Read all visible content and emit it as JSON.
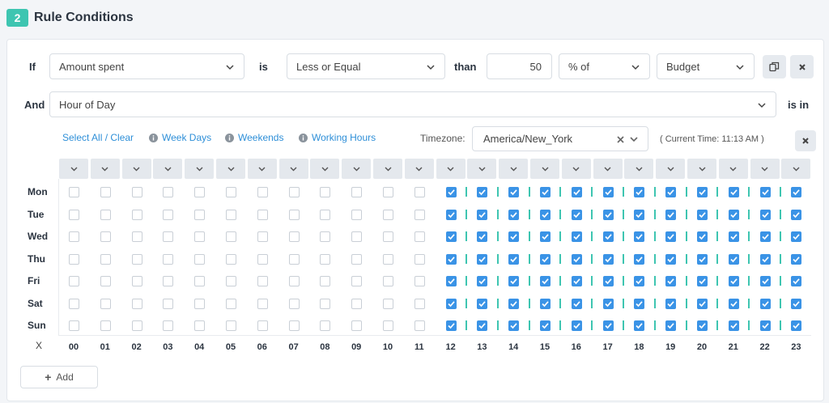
{
  "header": {
    "step_number": "2",
    "title": "Rule Conditions"
  },
  "condition": {
    "if_label": "If",
    "metric": "Amount spent",
    "is_label": "is",
    "operator": "Less or Equal",
    "than_label": "than",
    "value": "50",
    "unit": "% of",
    "reference": "Budget"
  },
  "and_condition": {
    "and_label": "And",
    "field": "Hour of Day",
    "is_in_label": "is in"
  },
  "toolbar": {
    "select_all": "Select All / Clear",
    "week_days": "Week Days",
    "weekends": "Weekends",
    "working_hours": "Working Hours",
    "timezone_label": "Timezone:",
    "timezone_value": "America/New_York",
    "current_time": "( Current Time: 11:13 AM )"
  },
  "schedule": {
    "days": [
      "Mon",
      "Tue",
      "Wed",
      "Thu",
      "Fri",
      "Sat",
      "Sun"
    ],
    "hours": [
      "00",
      "01",
      "02",
      "03",
      "04",
      "05",
      "06",
      "07",
      "08",
      "09",
      "10",
      "11",
      "12",
      "13",
      "14",
      "15",
      "16",
      "17",
      "18",
      "19",
      "20",
      "21",
      "22",
      "23"
    ],
    "x_label": "X",
    "selected_from_hour": 12,
    "selected_to_hour": 23
  },
  "add_button": "Add",
  "colors": {
    "accent": "#3ec5b1",
    "checkbox": "#3a93e6",
    "link": "#2e8fd8"
  }
}
